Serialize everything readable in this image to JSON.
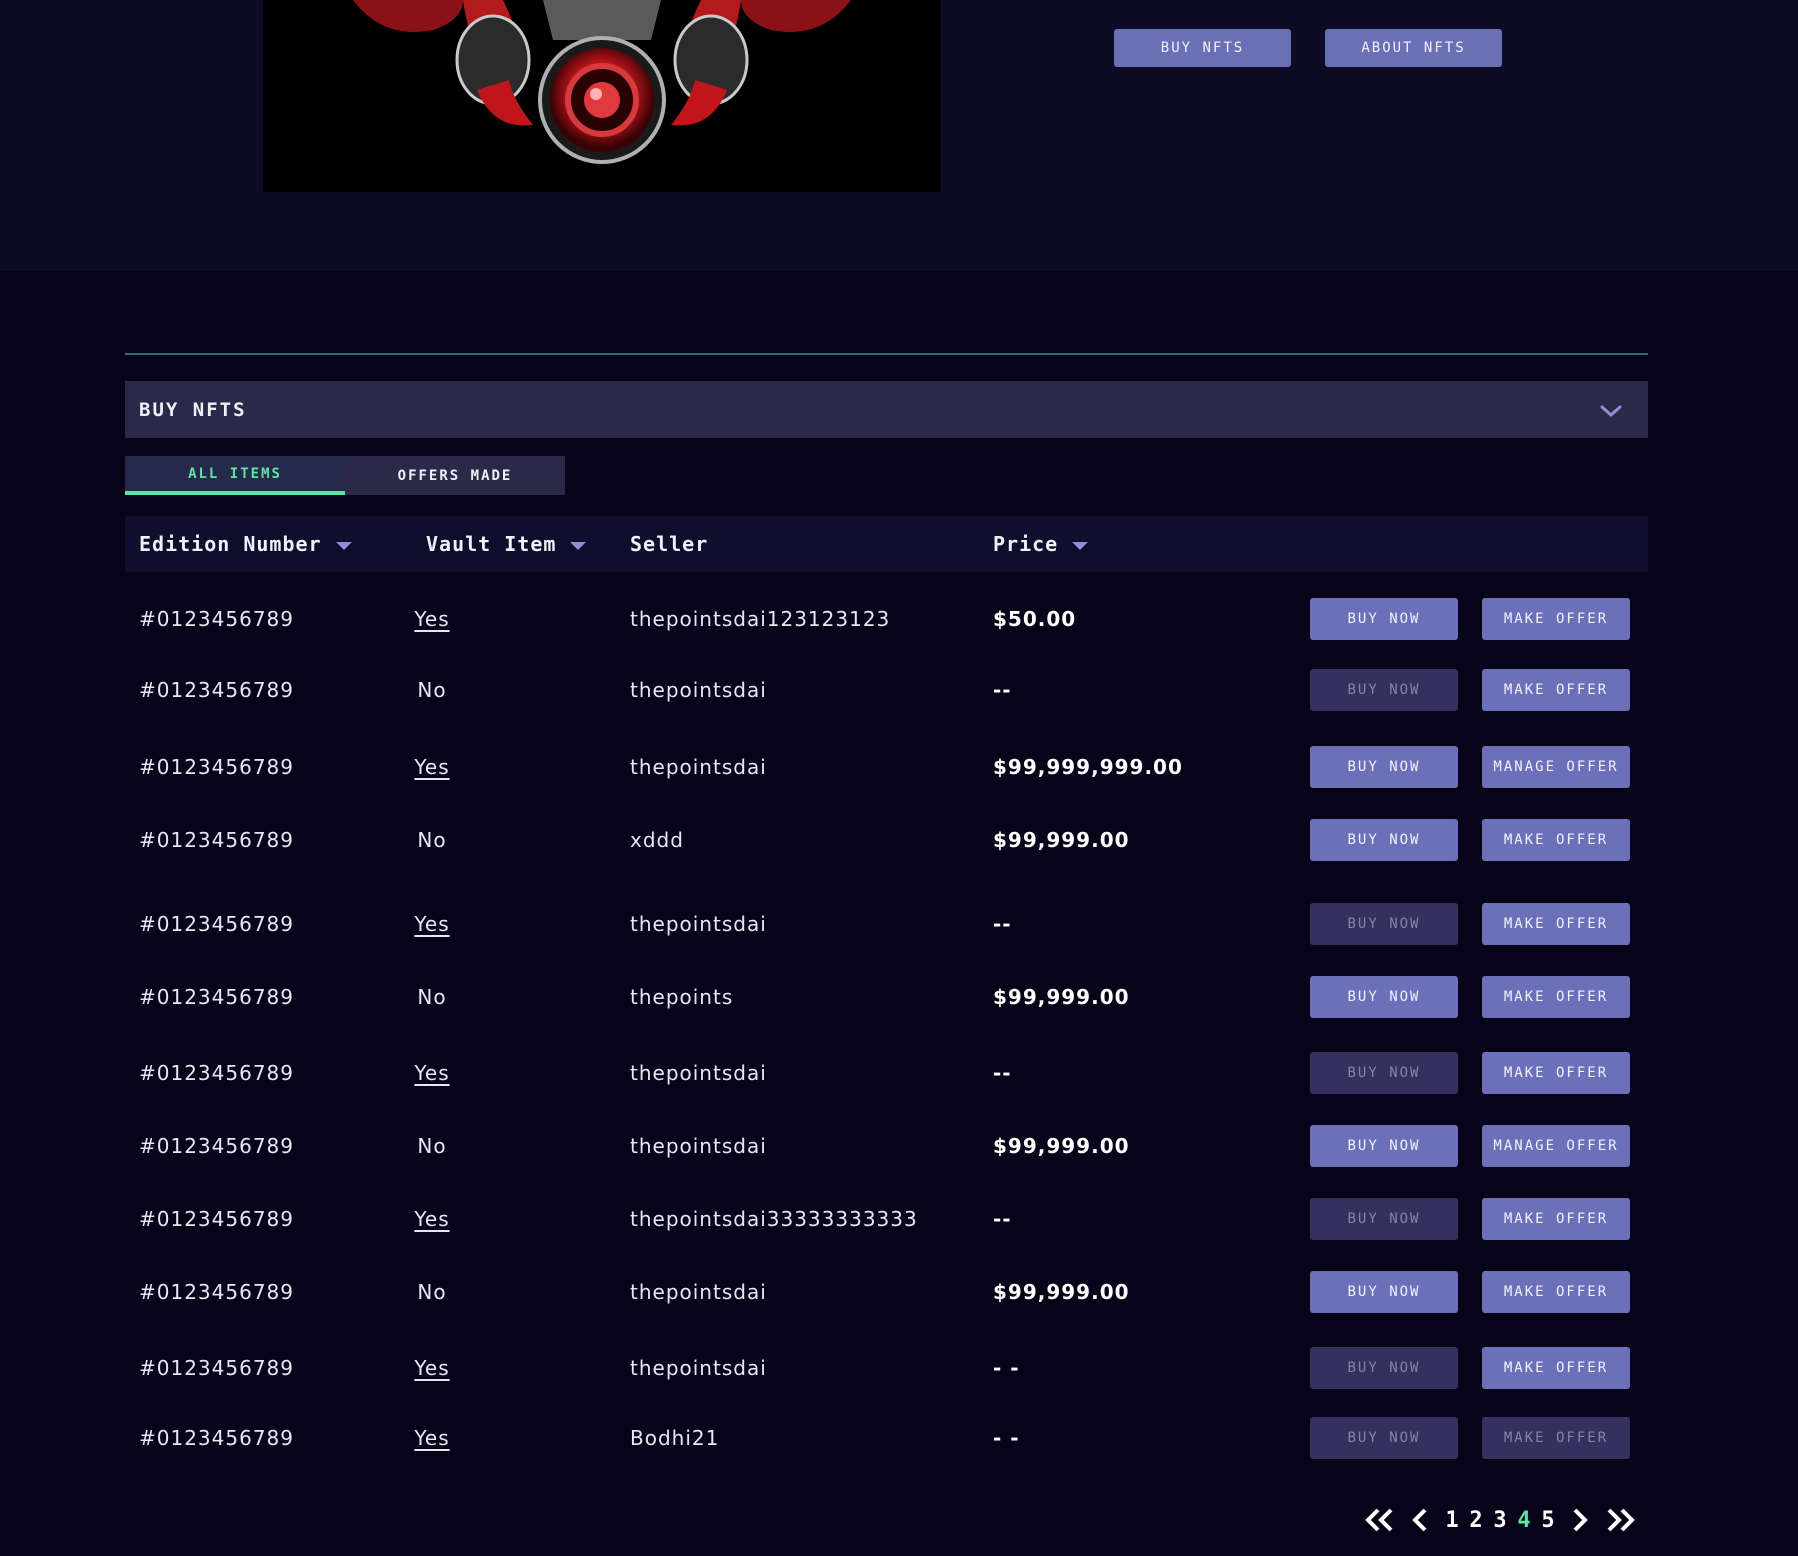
{
  "hero": {
    "buy_nfts_label": "BUY NFTS",
    "about_nfts_label": "ABOUT NFTS"
  },
  "accordion": {
    "title": "BUY NFTS"
  },
  "tabs": [
    {
      "label": "ALL ITEMS",
      "active": true
    },
    {
      "label": "OFFERS MADE",
      "active": false
    }
  ],
  "table": {
    "headers": {
      "edition": "Edition Number",
      "vault": "Vault Item",
      "seller": "Seller",
      "price": "Price"
    },
    "rows": [
      {
        "edition": "#0123456789",
        "vault": "Yes",
        "seller": "thepointsdai123123123",
        "price": "$50.00",
        "buy": "BUY NOW",
        "buy_enabled": true,
        "offer": "MAKE OFFER",
        "offer_enabled": true
      },
      {
        "edition": "#0123456789",
        "vault": "No",
        "seller": "thepointsdai",
        "price": "--",
        "buy": "BUY NOW",
        "buy_enabled": false,
        "offer": "MAKE OFFER",
        "offer_enabled": true
      },
      {
        "edition": "#0123456789",
        "vault": "Yes",
        "seller": "thepointsdai",
        "price": "$99,999,999.00",
        "buy": "BUY NOW",
        "buy_enabled": true,
        "offer": "MANAGE OFFER",
        "offer_enabled": true
      },
      {
        "edition": "#0123456789",
        "vault": "No",
        "seller": "xddd",
        "price": "$99,999.00",
        "buy": "BUY NOW",
        "buy_enabled": true,
        "offer": "MAKE OFFER",
        "offer_enabled": true
      },
      {
        "edition": "#0123456789",
        "vault": "Yes",
        "seller": "thepointsdai",
        "price": "--",
        "buy": "BUY NOW",
        "buy_enabled": false,
        "offer": "MAKE OFFER",
        "offer_enabled": true
      },
      {
        "edition": "#0123456789",
        "vault": "No",
        "seller": "thepoints",
        "price": "$99,999.00",
        "buy": "BUY NOW",
        "buy_enabled": true,
        "offer": "MAKE OFFER",
        "offer_enabled": true
      },
      {
        "edition": "#0123456789",
        "vault": "Yes",
        "seller": "thepointsdai",
        "price": "--",
        "buy": "BUY NOW",
        "buy_enabled": false,
        "offer": "MAKE OFFER",
        "offer_enabled": true
      },
      {
        "edition": "#0123456789",
        "vault": "No",
        "seller": "thepointsdai",
        "price": "$99,999.00",
        "buy": "BUY NOW",
        "buy_enabled": true,
        "offer": "MANAGE OFFER",
        "offer_enabled": true
      },
      {
        "edition": "#0123456789",
        "vault": "Yes",
        "seller": "thepointsdai33333333333",
        "price": "--",
        "buy": "BUY NOW",
        "buy_enabled": false,
        "offer": "MAKE OFFER",
        "offer_enabled": true
      },
      {
        "edition": "#0123456789",
        "vault": "No",
        "seller": "thepointsdai",
        "price": "$99,999.00",
        "buy": "BUY NOW",
        "buy_enabled": true,
        "offer": "MAKE OFFER",
        "offer_enabled": true
      },
      {
        "edition": "#0123456789",
        "vault": "Yes",
        "seller": "thepointsdai",
        "price": "- -",
        "buy": "BUY NOW",
        "buy_enabled": false,
        "offer": "MAKE OFFER",
        "offer_enabled": true
      },
      {
        "edition": "#0123456789",
        "vault": "Yes",
        "seller": "Bodhi21",
        "price": "- -",
        "buy": "BUY NOW",
        "buy_enabled": false,
        "offer": "MAKE OFFER",
        "offer_enabled": false
      }
    ]
  },
  "pagination": {
    "pages": [
      "1",
      "2",
      "3",
      "4",
      "5"
    ],
    "current": "4"
  },
  "colors": {
    "accent": "#5fe3a6",
    "button": "#6b70b8",
    "button_disabled": "#34315e",
    "background": "#07041a"
  }
}
